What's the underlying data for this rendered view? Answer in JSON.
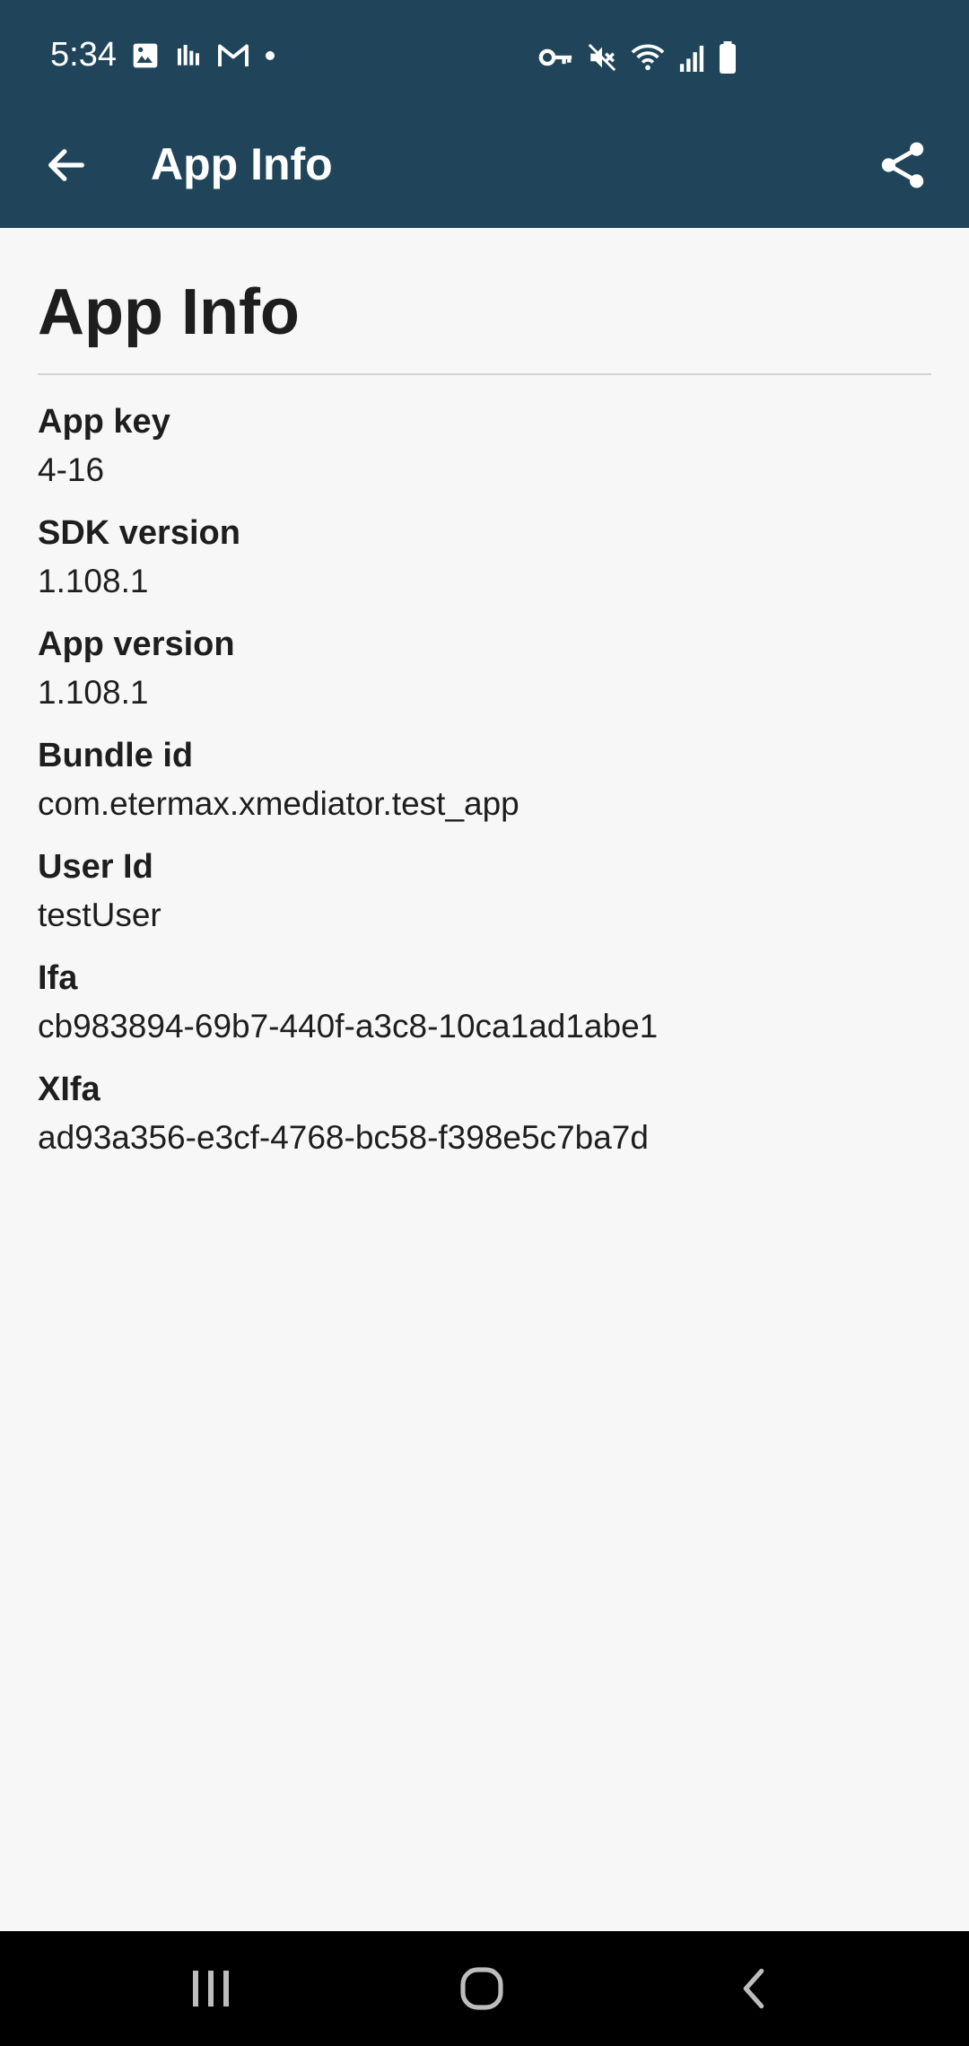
{
  "status_bar": {
    "time": "5:34",
    "left_icons": [
      "image-icon",
      "voicemail-bars-icon",
      "gmail-icon",
      "dot-icon"
    ],
    "right_icons": [
      "vpn-key-icon",
      "mute-icon",
      "wifi-icon",
      "signal-icon",
      "battery-icon"
    ]
  },
  "app_bar": {
    "title": "App Info",
    "back_icon": "arrow-back-icon",
    "share_icon": "share-icon",
    "background": "#20455a"
  },
  "page": {
    "title": "App Info",
    "items": [
      {
        "label": "App key",
        "value": "4-16"
      },
      {
        "label": "SDK version",
        "value": "1.108.1"
      },
      {
        "label": "App version",
        "value": "1.108.1"
      },
      {
        "label": "Bundle id",
        "value": "com.etermax.xmediator.test_app"
      },
      {
        "label": "User Id",
        "value": "testUser"
      },
      {
        "label": "Ifa",
        "value": "cb983894-69b7-440f-a3c8-10ca1ad1abe1"
      },
      {
        "label": "XIfa",
        "value": "ad93a356-e3cf-4768-bc58-f398e5c7ba7d"
      }
    ]
  },
  "nav_bar": {
    "buttons": [
      "recents-icon",
      "home-icon",
      "back-nav-icon"
    ]
  }
}
